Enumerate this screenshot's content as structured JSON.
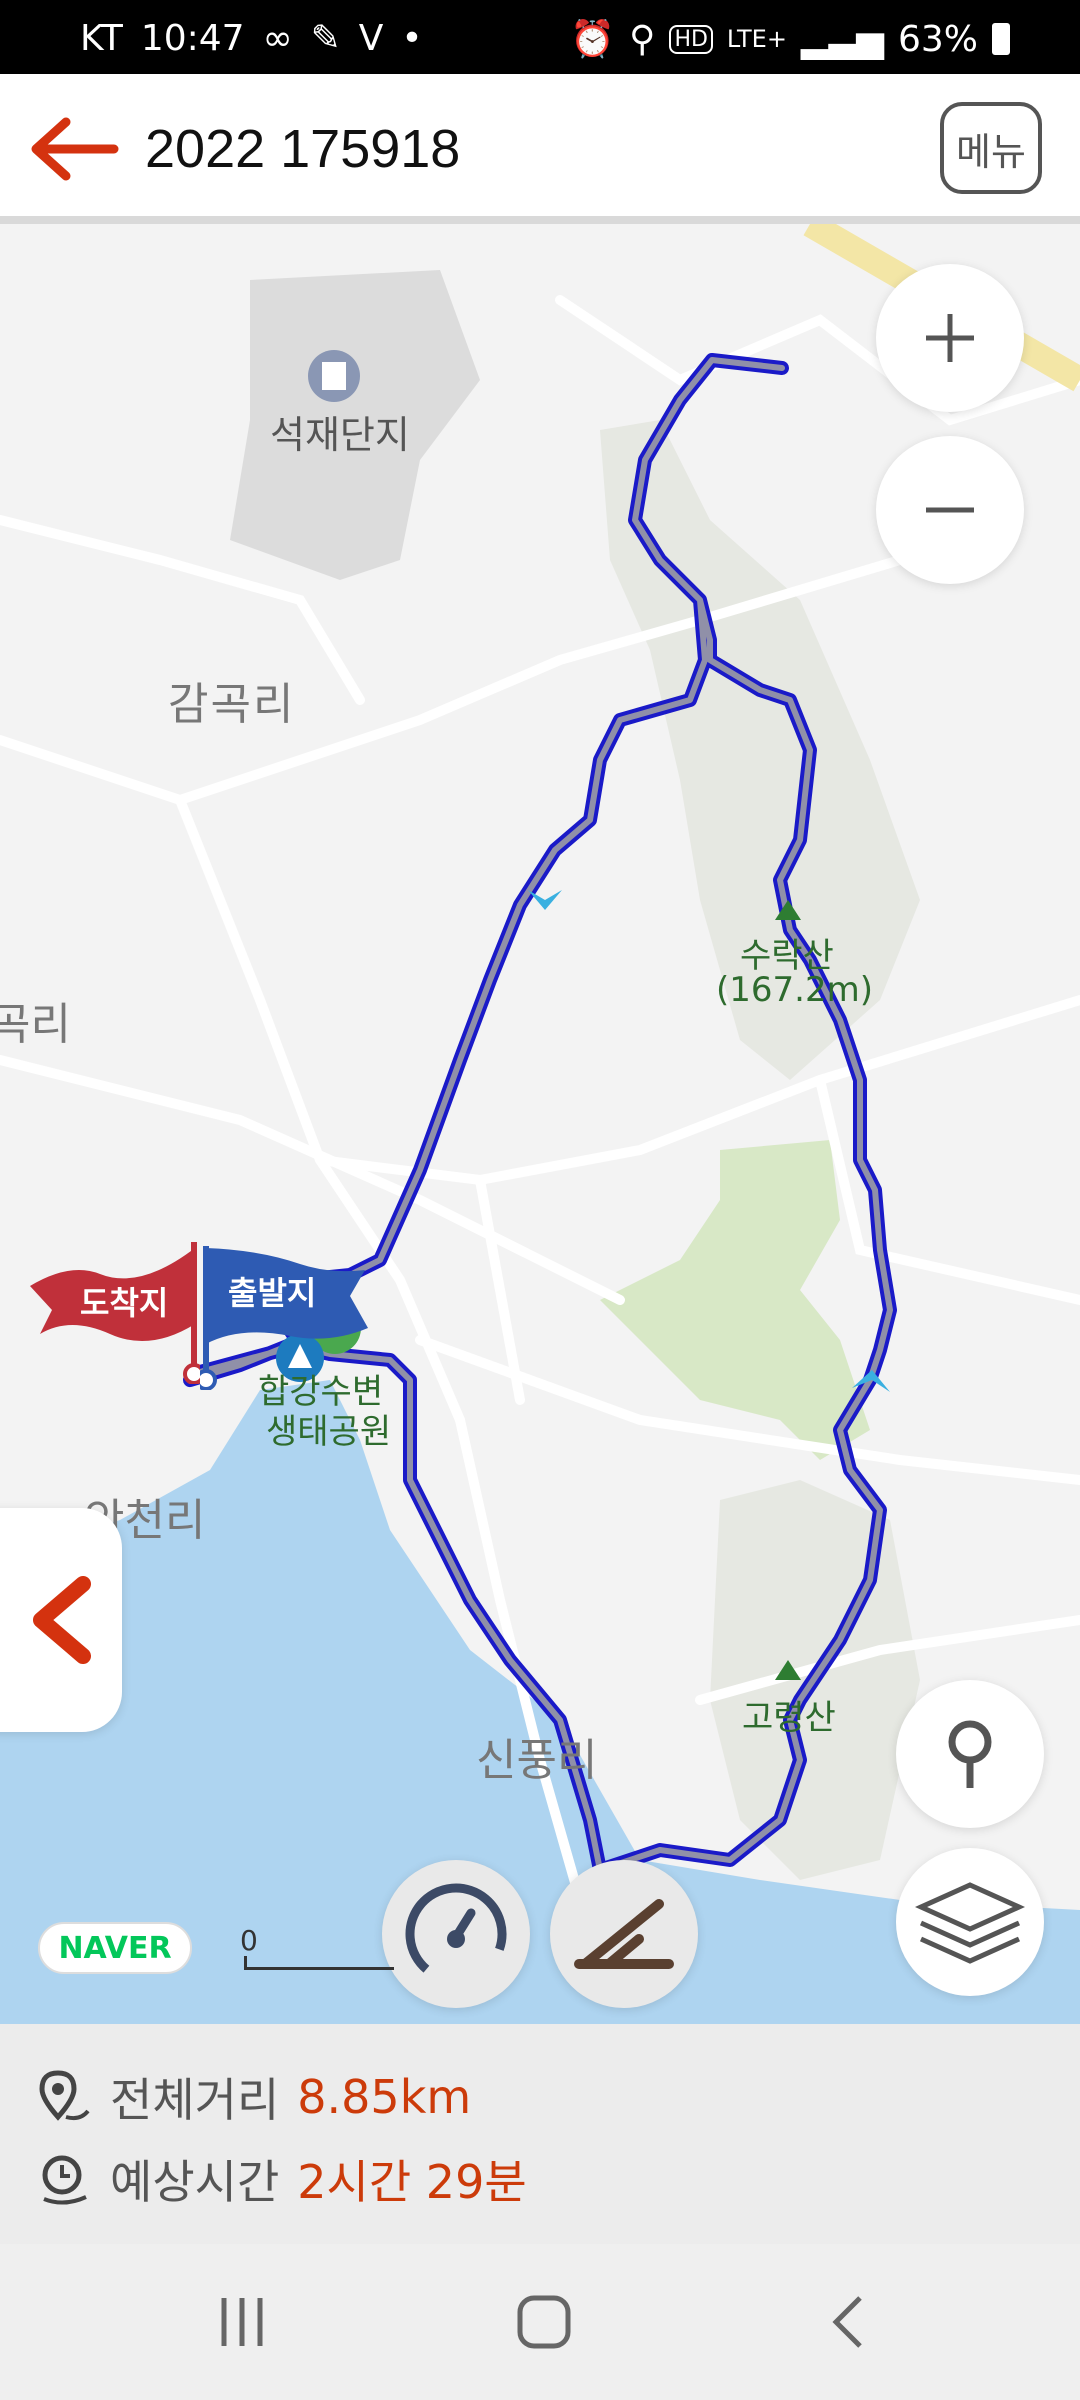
{
  "statusbar": {
    "carrier": "KT",
    "time": "10:47",
    "battery": "63%",
    "network": "LTE+"
  },
  "header": {
    "title": "2022 175918",
    "menu_label": "메뉴"
  },
  "map": {
    "labels": {
      "industrial": "석재단지",
      "village1": "감곡리",
      "village2": "곡리",
      "village3": "안천리",
      "village4": "신풍리",
      "mountain1_name": "수락산",
      "mountain1_height": "(167.2m)",
      "mountain2": "고령산",
      "park_line1": "합강수변",
      "park_line2": "생태공원"
    },
    "flags": {
      "arrival": "도착지",
      "departure": "출발지"
    },
    "provider": "NAVER",
    "scale_zero": "0",
    "colors": {
      "route_outer": "#1a1ac8",
      "route_inner": "#8a8aa0",
      "arrival_flag": "#c0303a",
      "departure_flag": "#2e5bb3",
      "water": "#aed4f0",
      "accent": "#d4320f"
    }
  },
  "info": {
    "distance_label": "전체거리",
    "distance_value": "8.85km",
    "time_label": "예상시간",
    "time_value": "2시간 29분"
  },
  "icons": [
    "back-arrow-icon",
    "zoom-in-icon",
    "zoom-out-icon",
    "side-back-icon",
    "location-icon",
    "layers-icon",
    "speedometer-icon",
    "elevation-icon",
    "distance-pin-icon",
    "time-icon"
  ]
}
